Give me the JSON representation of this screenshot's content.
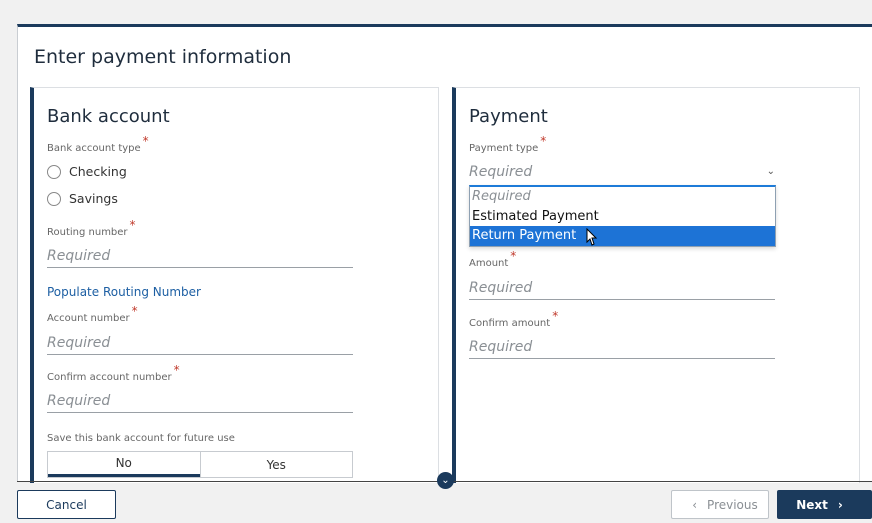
{
  "page_title": "Enter payment information",
  "bank": {
    "title": "Bank account",
    "account_type_label": "Bank account type",
    "options": [
      "Checking",
      "Savings"
    ],
    "routing_label": "Routing number",
    "routing_placeholder": "Required",
    "populate_link": "Populate Routing Number",
    "account_label": "Account number",
    "account_placeholder": "Required",
    "confirm_label": "Confirm account number",
    "confirm_placeholder": "Required",
    "save_label": "Save this bank account for future use",
    "save_options": [
      "No",
      "Yes"
    ],
    "save_selected": "No"
  },
  "payment": {
    "title": "Payment",
    "type_label": "Payment type",
    "type_value": "Required",
    "dropdown_options": [
      "Required",
      "Estimated Payment",
      "Return Payment"
    ],
    "dropdown_highlighted": "Return Payment",
    "amount_label": "Amount",
    "amount_placeholder": "Required",
    "confirm_amount_label": "Confirm amount",
    "confirm_amount_placeholder": "Required"
  },
  "required_marker": "*",
  "footer": {
    "cancel": "Cancel",
    "previous": "Previous",
    "next": "Next"
  }
}
